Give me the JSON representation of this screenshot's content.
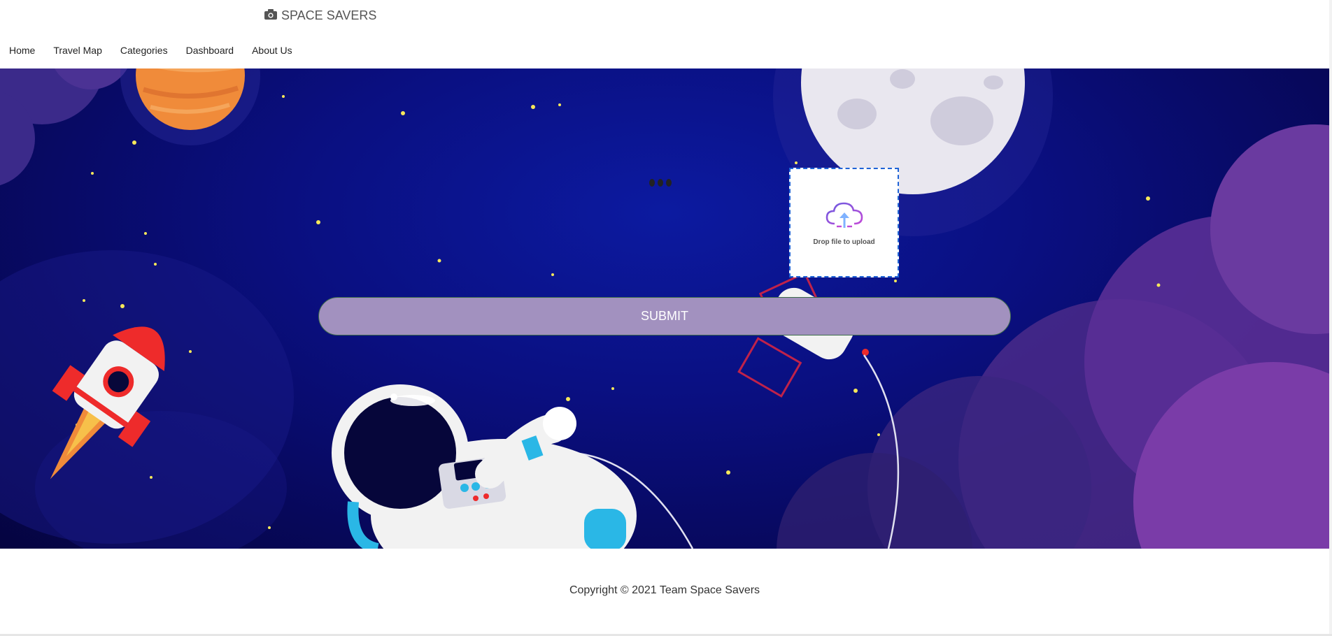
{
  "brand": {
    "title": "SPACE SAVERS",
    "icon": "camera-icon"
  },
  "nav": {
    "items": [
      {
        "label": "Home"
      },
      {
        "label": "Travel Map"
      },
      {
        "label": "Categories"
      },
      {
        "label": "Dashboard"
      },
      {
        "label": "About Us"
      }
    ]
  },
  "upload": {
    "label": "Drop file to upload",
    "icon": "cloud-upload-icon"
  },
  "form": {
    "submit_label": "SUBMIT"
  },
  "footer": {
    "copyright": "Copyright © 2021 Team Space Savers"
  },
  "colors": {
    "submit_bg": "#a291bf",
    "dropzone_border": "#1f63d6",
    "hero_bg": "#0a0f80"
  }
}
